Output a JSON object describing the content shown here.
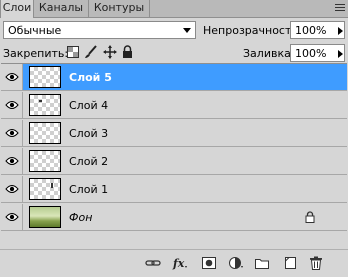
{
  "tabs": [
    {
      "label": "Слои"
    },
    {
      "label": "Каналы"
    },
    {
      "label": "Контуры"
    }
  ],
  "blend_mode": {
    "value": "Обычные"
  },
  "opacity": {
    "label": "Непрозрачность:",
    "value": "100%"
  },
  "lock": {
    "label": "Закрепить:"
  },
  "fill": {
    "label": "Заливка:",
    "value": "100%"
  },
  "layers": [
    {
      "name": "Слой 5",
      "selected": true
    },
    {
      "name": "Слой 4"
    },
    {
      "name": "Слой 3"
    },
    {
      "name": "Слой 2"
    },
    {
      "name": "Слой 1"
    },
    {
      "name": "Фон",
      "locked": true
    }
  ],
  "footer_icons": [
    "link-layers-icon",
    "fx-icon",
    "add-mask-icon",
    "adjustment-layer-icon",
    "new-group-icon",
    "new-layer-icon",
    "trash-icon"
  ],
  "colors": {
    "selection": "#3f9cff",
    "panel": "#d6d6d6"
  }
}
